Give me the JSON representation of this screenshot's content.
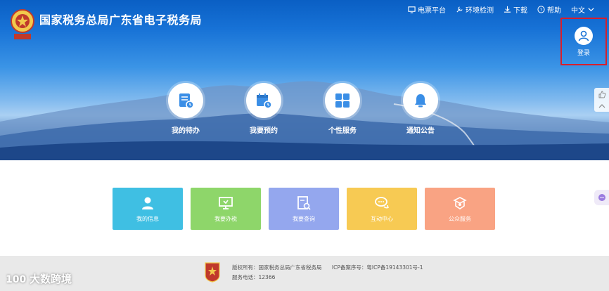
{
  "header": {
    "site_title": "国家税务总局广东省电子税务局"
  },
  "topnav": {
    "items": [
      {
        "label": "电票平台",
        "icon": "monitor-icon"
      },
      {
        "label": "环境检测",
        "icon": "tools-icon"
      },
      {
        "label": "下载",
        "icon": "download-icon"
      },
      {
        "label": "帮助",
        "icon": "help-icon"
      },
      {
        "label": "中文",
        "icon": "chevron-down-icon"
      }
    ]
  },
  "login": {
    "label": "登录",
    "highlight_color": "#d81e2c"
  },
  "shortcuts": [
    {
      "label": "我的待办",
      "icon": "todo-document-icon"
    },
    {
      "label": "我要预约",
      "icon": "calendar-clock-icon"
    },
    {
      "label": "个性服务",
      "icon": "grid-icon"
    },
    {
      "label": "通知公告",
      "icon": "bell-icon"
    }
  ],
  "cards": [
    {
      "label": "我的信息",
      "icon": "user-icon",
      "color": "#3fbfe3"
    },
    {
      "label": "我要办税",
      "icon": "monitor-tax-icon",
      "color": "#8ed66a"
    },
    {
      "label": "我要查询",
      "icon": "document-search-icon",
      "color": "#94a7ee"
    },
    {
      "label": "互动中心",
      "icon": "chat-bubbles-icon",
      "color": "#f7ca53"
    },
    {
      "label": "公众服务",
      "icon": "public-service-icon",
      "color": "#f9a383"
    }
  ],
  "footer": {
    "copyright": "版权所有：国家税务总局广东省税务局",
    "icp": "ICP备案序号：粤ICP备19143301号-1",
    "phone": "服务电话：12366"
  },
  "watermark": {
    "text": "大数跨境"
  }
}
